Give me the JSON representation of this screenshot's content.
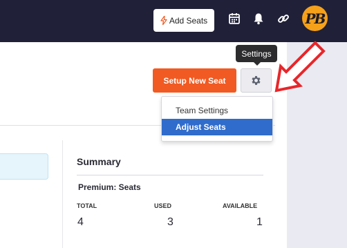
{
  "colors": {
    "topbar": "#202138",
    "accent_orange": "#f15a22",
    "dropdown_active": "#2f6ccc",
    "arrow_red": "#e8262a",
    "avatar_bg": "#f6a11a"
  },
  "topbar": {
    "add_seats_label": "Add Seats",
    "add_seats_icon": "bolt-icon",
    "icons": [
      "calendar-icon",
      "bell-icon",
      "link-icon"
    ],
    "avatar_initials": "PB"
  },
  "toolbar": {
    "setup_new_seat_label": "Setup New Seat",
    "settings_icon": "gear-icon",
    "settings_tooltip": "Settings"
  },
  "settings_menu": {
    "items": [
      {
        "label": "Team Settings",
        "selected": false
      },
      {
        "label": "Adjust Seats",
        "selected": true
      }
    ]
  },
  "summary": {
    "title": "Summary",
    "plan_label": "Premium: Seats",
    "stats": [
      {
        "label": "TOTAL",
        "value": "4"
      },
      {
        "label": "USED",
        "value": "3"
      },
      {
        "label": "AVAILABLE",
        "value": "1"
      }
    ]
  }
}
